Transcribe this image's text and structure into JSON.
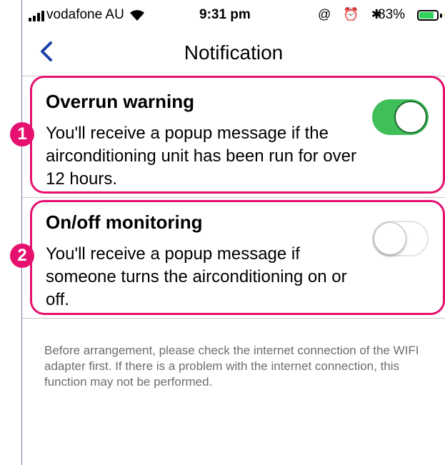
{
  "status_bar": {
    "carrier": "vodafone AU",
    "time": "9:31 pm",
    "icons": "@ ⏰ ✱",
    "battery_percent": "83%",
    "battery_level": 0.83,
    "charging_symbol": "⚡"
  },
  "nav": {
    "title": "Notification",
    "back_icon": "chevron-left-icon"
  },
  "settings": [
    {
      "title": "Overrun warning",
      "description": "You'll receive a popup message if the airconditioning unit has been run for over 12 hours.",
      "enabled": true,
      "annotation_number": "1"
    },
    {
      "title": "On/off monitoring",
      "description": "You'll receive a popup message if someone turns the airconditioning on or off.",
      "enabled": false,
      "annotation_number": "2"
    }
  ],
  "footer_note": "Before arrangement, please check the internet connection of the WIFI adapter first. If there is a problem with the internet connection, this function may not be performed.",
  "colors": {
    "accent": "#1b3fa8",
    "toggle_on": "#3fbf5a",
    "annotation": "#e6116f",
    "battery": "#2fd35a"
  }
}
